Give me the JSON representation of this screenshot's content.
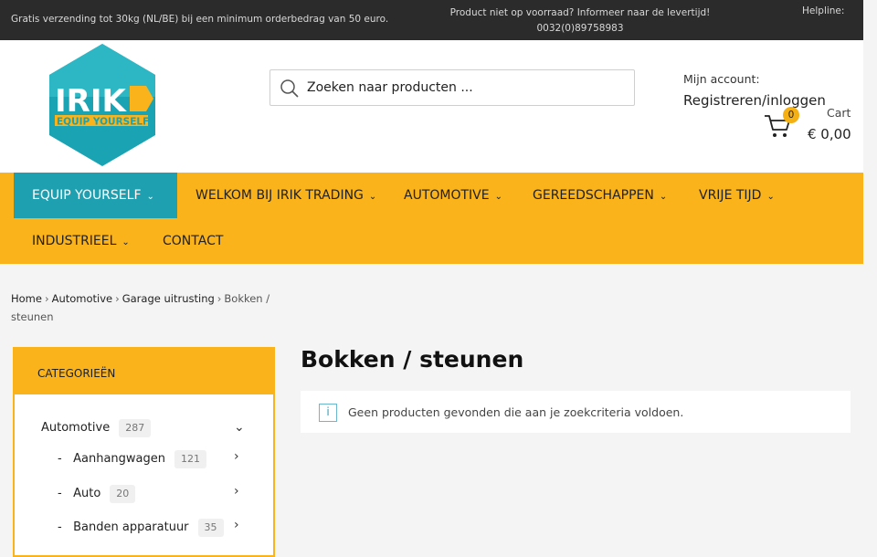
{
  "topbar": {
    "shipping": "Gratis verzending tot 30kg (NL/BE) bij een minimum orderbedrag van 50 euro.",
    "stock_line1": "Product niet op voorraad? Informeer naar de levertijd!",
    "stock_line2": "0032(0)89758983",
    "helpline": "Helpline:"
  },
  "logo": {
    "brand": "IRIK",
    "tagline": "EQUIP YOURSELF",
    "teal": "#1aa3b3",
    "yellow": "#fab31b"
  },
  "search": {
    "placeholder": "Zoeken naar producten ..."
  },
  "account": {
    "label": "Mijn account:",
    "link": "Registreren/inloggen"
  },
  "cart": {
    "count": "0",
    "label": "Cart",
    "total": "€ 0,00"
  },
  "nav": {
    "items": [
      {
        "label": "EQUIP YOURSELF"
      },
      {
        "label": "WELKOM BIJ IRIK TRADING"
      },
      {
        "label": "AUTOMOTIVE"
      },
      {
        "label": "GEREEDSCHAPPEN"
      },
      {
        "label": "VRIJE TIJD"
      },
      {
        "label": "INDUSTRIEEL"
      },
      {
        "label": "CONTACT"
      }
    ],
    "accent": "#fab31b",
    "active_color": "#1fa0b0"
  },
  "breadcrumb": {
    "home": "Home",
    "automotive": "Automotive",
    "garage": "Garage uitrusting",
    "current": "Bokken / steunen"
  },
  "sidebar": {
    "title": "CATEGORIEËN",
    "categories": [
      {
        "name": "Automotive",
        "count": "287",
        "prefix": ""
      },
      {
        "name": "Aanhangwagen",
        "count": "121",
        "prefix": "-"
      },
      {
        "name": "Auto",
        "count": "20",
        "prefix": "-"
      },
      {
        "name": "Banden apparatuur",
        "count": "35",
        "prefix": "-"
      }
    ]
  },
  "main": {
    "title": "Bokken / steunen",
    "notice": "Geen producten gevonden die aan je zoekcriteria voldoen.",
    "notice_icon": "i"
  }
}
